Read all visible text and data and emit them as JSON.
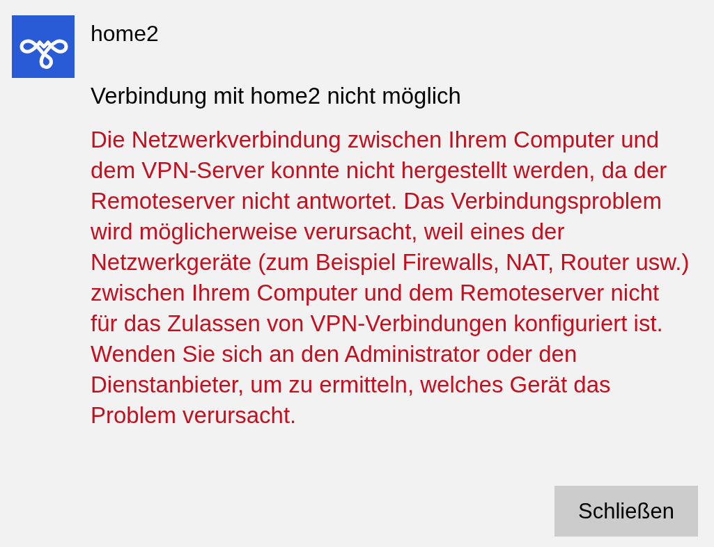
{
  "app": {
    "name": "home2"
  },
  "dialog": {
    "heading": "Verbindung mit home2 nicht möglich",
    "message": "Die Netzwerkverbindung zwischen Ihrem Computer und dem VPN-Server konnte nicht hergestellt werden, da der Remoteserver nicht antwortet. Das Verbindungsproblem wird möglicherweise verursacht, weil eines der Netzwerkgeräte (zum Beispiel Firewalls, NAT, Router usw.) zwischen Ihrem Computer und dem Remoteserver nicht für das Zulassen von VPN-Verbindungen konfiguriert ist. Wenden Sie sich an den Administrator oder den Dienstanbieter, um zu ermitteln, welches Gerät das Problem verursacht.",
    "buttons": [
      {
        "label": "Schließen"
      }
    ]
  }
}
